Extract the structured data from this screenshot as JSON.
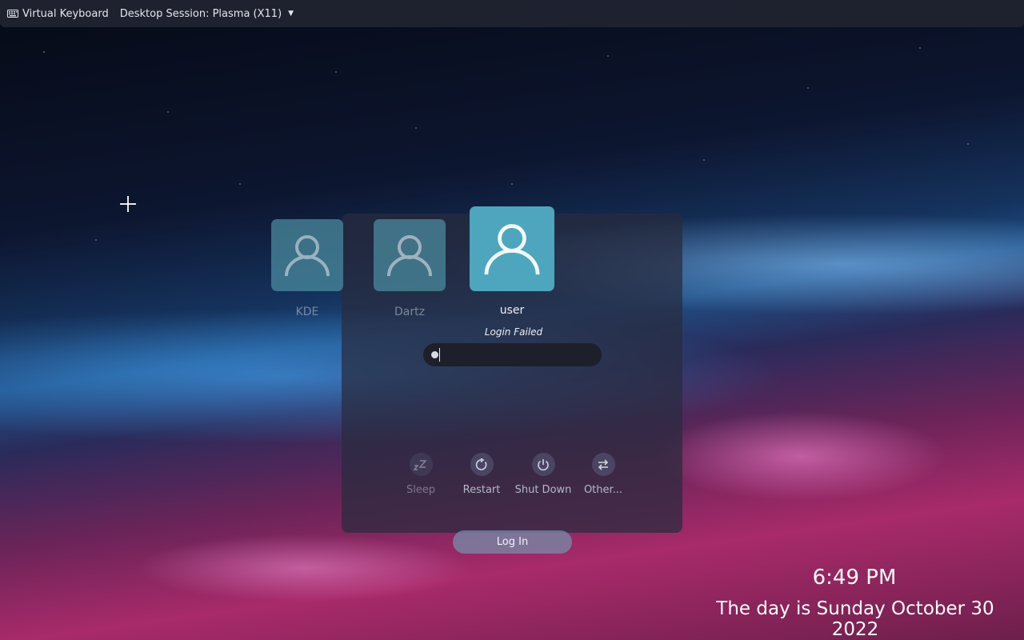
{
  "topbar": {
    "virtual_keyboard_label": "Virtual Keyboard",
    "session_label": "Desktop Session: Plasma (X11)"
  },
  "users": [
    {
      "name": "KDE"
    },
    {
      "name": "Dartz"
    },
    {
      "name": "user"
    }
  ],
  "login": {
    "status_message": "Login Failed",
    "password_masked": "●",
    "login_button_label": "Log In"
  },
  "actions": [
    {
      "label": "Sleep",
      "icon": "sleep-icon"
    },
    {
      "label": "Restart",
      "icon": "restart-icon"
    },
    {
      "label": "Shut Down",
      "icon": "power-icon"
    },
    {
      "label": "Other...",
      "icon": "switch-icon"
    }
  ],
  "clock": {
    "time": "6:49 PM",
    "date": "The day is Sunday October 30 2022"
  },
  "colors": {
    "avatar": "#4ea5be",
    "panel": "#282b3e",
    "topbar": "#202330"
  }
}
